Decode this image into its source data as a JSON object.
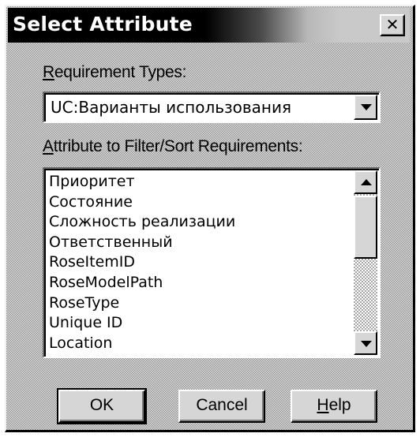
{
  "window": {
    "title": "Select Attribute",
    "close_glyph": "✕"
  },
  "requirement_types": {
    "label_underlined": "R",
    "label_rest": "equirement Types:",
    "selected_value": "UC:Варианты использования"
  },
  "attribute_list": {
    "label_underlined": "A",
    "label_rest": "ttribute to Filter/Sort Requirements:",
    "items": [
      "Приоритет",
      "Состояние",
      "Сложность реализации",
      "Ответственный",
      "RoseItemID",
      "RoseModelPath",
      "RoseType",
      "Unique ID",
      "Location"
    ]
  },
  "buttons": {
    "ok": "OK",
    "cancel": "Cancel",
    "help_underlined": "H",
    "help_rest": "elp"
  },
  "icons": {
    "close": "close-icon",
    "dropdown": "chevron-down-icon",
    "scroll_up": "arrow-up-icon",
    "scroll_down": "arrow-down-icon"
  }
}
